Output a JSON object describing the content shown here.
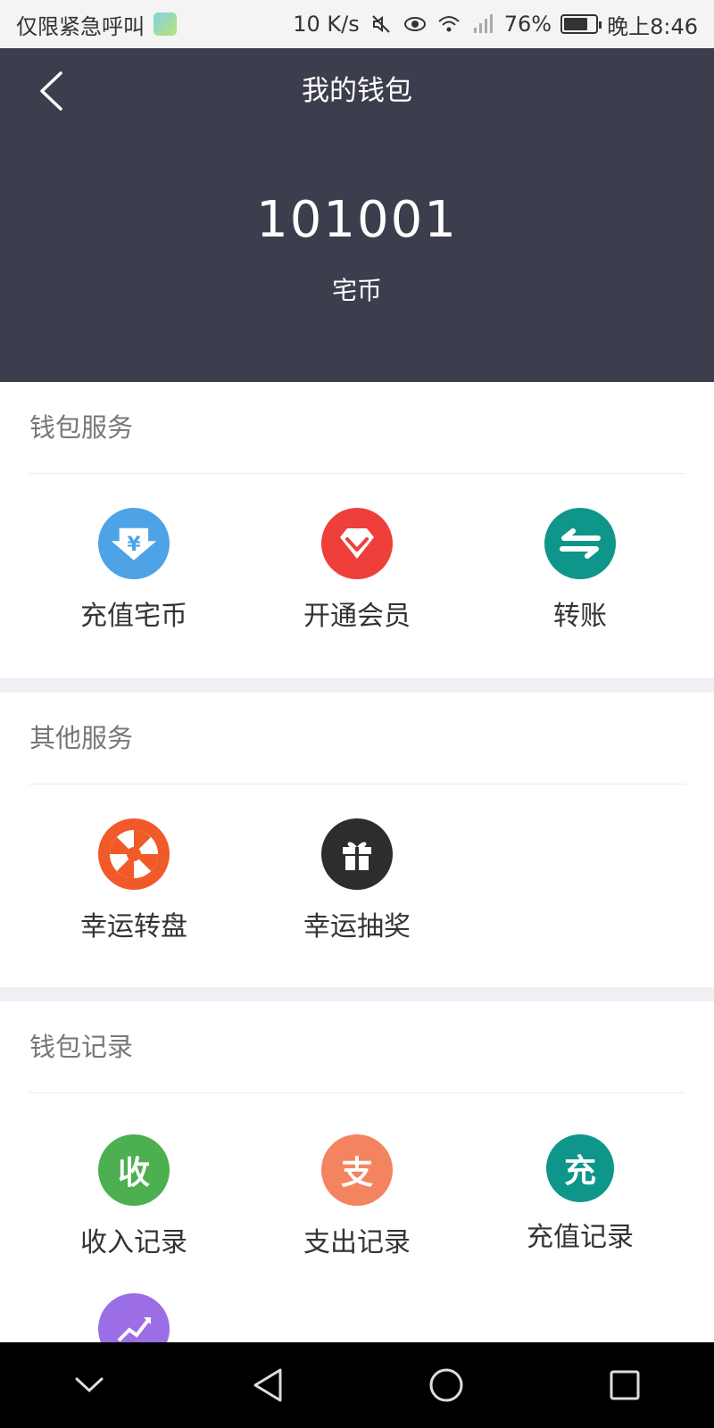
{
  "status_bar": {
    "carrier": "仅限紧急呼叫",
    "speed": "10 K/s",
    "battery": "76%",
    "battery_level": 0.76,
    "time": "晚上8:46"
  },
  "header": {
    "title": "我的钱包",
    "balance": "101001",
    "unit": "宅币"
  },
  "sections": {
    "wallet_services": {
      "title": "钱包服务",
      "items": [
        {
          "label": "充值宅币",
          "icon": "yen-download-icon",
          "color": "#4da3e6"
        },
        {
          "label": "开通会员",
          "icon": "diamond-icon",
          "color": "#ee3f3a"
        },
        {
          "label": "转账",
          "icon": "transfer-arrows-icon",
          "color": "#0e968a"
        }
      ]
    },
    "other_services": {
      "title": "其他服务",
      "items": [
        {
          "label": "幸运转盘",
          "icon": "wheel-icon",
          "color": "#f05a28"
        },
        {
          "label": "幸运抽奖",
          "icon": "gift-icon",
          "color": "#2d2d2d"
        }
      ]
    },
    "wallet_records": {
      "title": "钱包记录",
      "items": [
        {
          "label": "收入记录",
          "glyph": "收",
          "icon": "income-icon",
          "color": "#4caf50"
        },
        {
          "label": "支出记录",
          "glyph": "支",
          "icon": "expense-icon",
          "color": "#f4845f"
        },
        {
          "label": "充值记录",
          "glyph": "充",
          "icon": "recharge-icon",
          "color": "#0e968a"
        },
        {
          "label": "",
          "icon": "chart-growth-icon",
          "color": "#9b6ee6"
        }
      ]
    }
  }
}
